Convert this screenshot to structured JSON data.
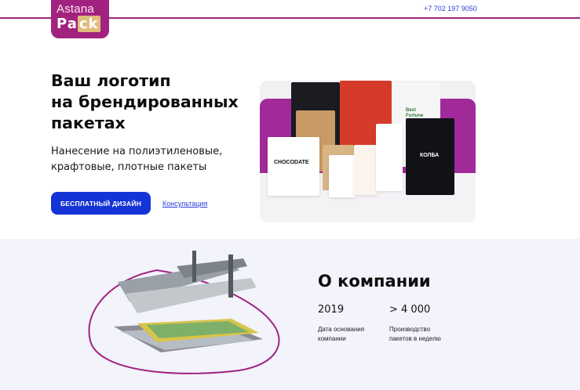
{
  "header": {
    "logo_top": "Astana",
    "logo_bottom_a": "Pa",
    "logo_bottom_b": "ck",
    "phone": "+7 702 197 9050"
  },
  "hero": {
    "title_lines": [
      "Ваш логотип",
      "на брендированных",
      "пакетах"
    ],
    "subtitle_lines": [
      "Нанесение на полиэтиленовые,",
      "крафтовые, плотные пакеты"
    ],
    "cta_label": "БЕСПЛАТНЫЙ ДИЗАЙН",
    "consult_label": "Консультация"
  },
  "photo": {
    "bag_labels": {
      "chocodate": "CHOCODATE",
      "best_fortune": "Best Fortune",
      "kolba": "КОЛБА"
    }
  },
  "about": {
    "title": "О компании",
    "stats": [
      {
        "value": "2019",
        "label_lines": [
          "Дата основания",
          "компании"
        ]
      },
      {
        "value": "> 4 000",
        "label_lines": [
          "Производство",
          "пакетов в неделю"
        ]
      }
    ]
  },
  "colors": {
    "brand": "#a2237f",
    "accent_blue": "#1434d6",
    "link": "#2b3fd9",
    "section_bg": "#f2f3fb"
  }
}
